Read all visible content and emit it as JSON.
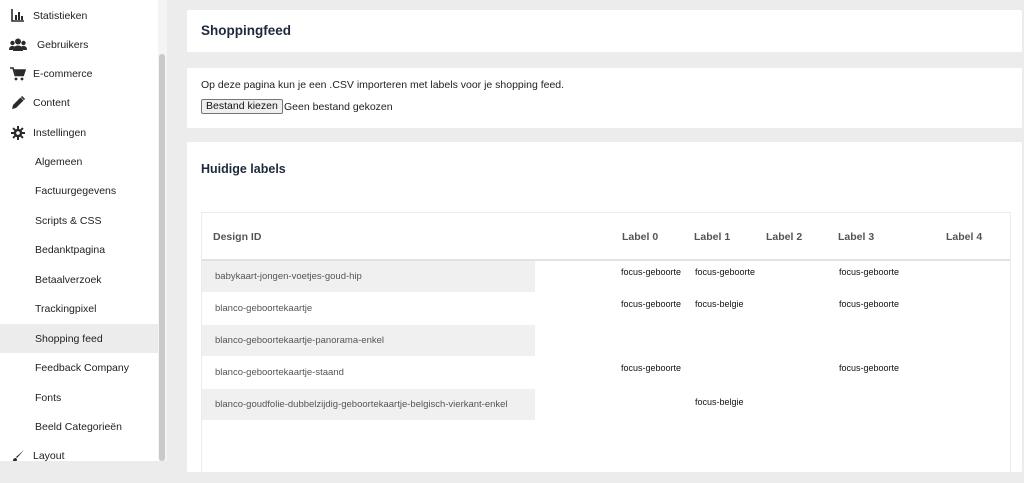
{
  "sidebar": {
    "items": [
      {
        "label": "Statistieken",
        "icon": "bar-chart-icon",
        "sub": false,
        "active": false
      },
      {
        "label": "Gebruikers",
        "icon": "users-icon",
        "sub": false,
        "active": false
      },
      {
        "label": "E-commerce",
        "icon": "cart-icon",
        "sub": false,
        "active": false
      },
      {
        "label": "Content",
        "icon": "pencil-icon",
        "sub": false,
        "active": false
      },
      {
        "label": "Instellingen",
        "icon": "gear-icon",
        "sub": false,
        "active": false
      },
      {
        "label": "Algemeen",
        "sub": true,
        "active": false
      },
      {
        "label": "Factuurgegevens",
        "sub": true,
        "active": false
      },
      {
        "label": "Scripts & CSS",
        "sub": true,
        "active": false
      },
      {
        "label": "Bedanktpagina",
        "sub": true,
        "active": false
      },
      {
        "label": "Betaalverzoek",
        "sub": true,
        "active": false
      },
      {
        "label": "Trackingpixel",
        "sub": true,
        "active": false
      },
      {
        "label": "Shopping feed",
        "sub": true,
        "active": true
      },
      {
        "label": "Feedback Company",
        "sub": true,
        "active": false
      },
      {
        "label": "Fonts",
        "sub": true,
        "active": false
      },
      {
        "label": "Beeld Categorieën",
        "sub": true,
        "active": false
      },
      {
        "label": "Layout",
        "icon": "brush-icon",
        "sub": false,
        "active": false
      }
    ]
  },
  "header": {
    "title": "Shoppingfeed"
  },
  "import": {
    "description": "Op deze pagina kun je een .CSV importeren met labels voor je shopping feed.",
    "file_button": "Bestand kiezen",
    "no_file": "Geen bestand gekozen"
  },
  "labels": {
    "title": "Huidige labels",
    "columns": [
      "Design ID",
      "Label 0",
      "Label 1",
      "Label 2",
      "Label 3",
      "Label 4"
    ],
    "rows": [
      {
        "design_id": "babykaart-jongen-voetjes-goud-hip",
        "l0": "focus-geboorte",
        "l1": "focus-geboorte",
        "l2": "",
        "l3": "focus-geboorte",
        "l4": ""
      },
      {
        "design_id": "blanco-geboortekaartje",
        "l0": "focus-geboorte",
        "l1": "focus-belgie",
        "l2": "",
        "l3": "focus-geboorte",
        "l4": ""
      },
      {
        "design_id": "blanco-geboortekaartje-panorama-enkel",
        "l0": "",
        "l1": "",
        "l2": "",
        "l3": "",
        "l4": ""
      },
      {
        "design_id": "blanco-geboortekaartje-staand",
        "l0": "focus-geboorte",
        "l1": "",
        "l2": "",
        "l3": "focus-geboorte",
        "l4": ""
      },
      {
        "design_id": "blanco-goudfolie-dubbelzijdig-geboortekaartje-belgisch-vierkant-enkel",
        "l0": "",
        "l1": "focus-belgie",
        "l2": "",
        "l3": "",
        "l4": ""
      }
    ]
  }
}
